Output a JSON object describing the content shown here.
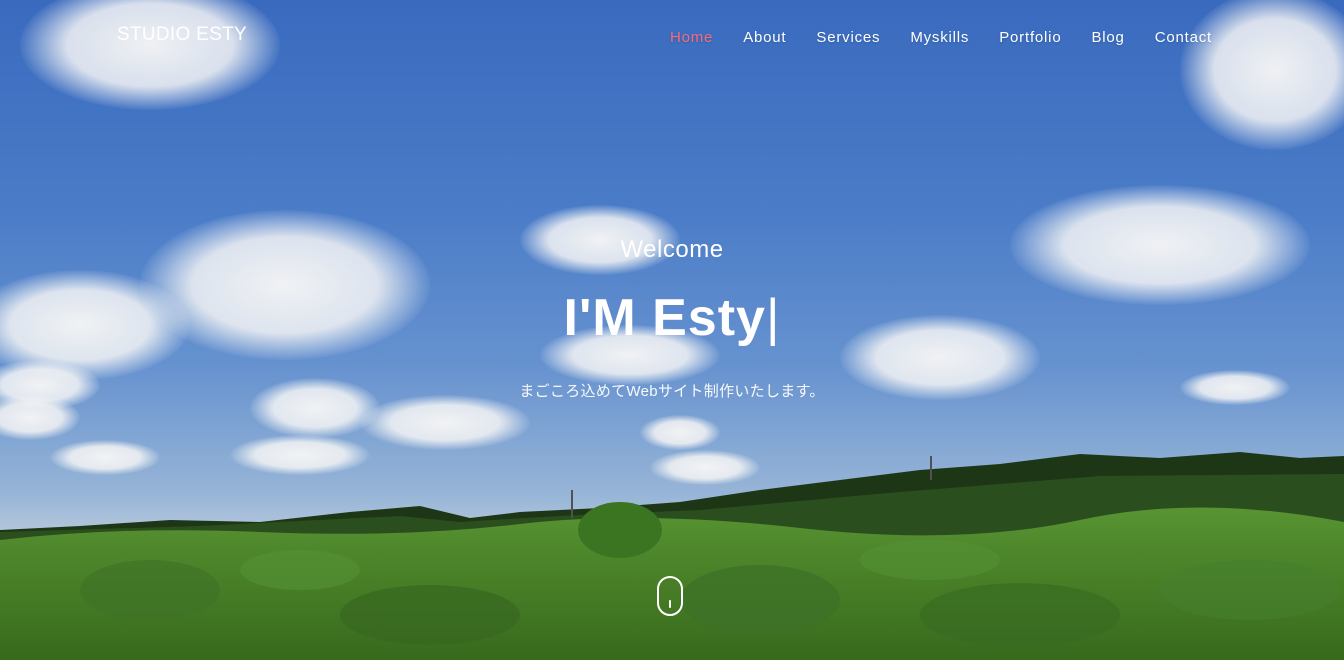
{
  "brand": "STUDIO ESTY",
  "nav": {
    "items": [
      {
        "label": "Home",
        "active": true
      },
      {
        "label": "About",
        "active": false
      },
      {
        "label": "Services",
        "active": false
      },
      {
        "label": "Myskills",
        "active": false
      },
      {
        "label": "Portfolio",
        "active": false
      },
      {
        "label": "Blog",
        "active": false
      },
      {
        "label": "Contact",
        "active": false
      }
    ],
    "active_color": "#f56b7a"
  },
  "hero": {
    "welcome": "Welcome",
    "headline": "I'M Esty",
    "cursor": "|",
    "subtitle": "まごころ込めてWebサイト制作いたします。"
  },
  "icons": {
    "scroll_indicator": "mouse-scroll-icon"
  },
  "colors": {
    "sky": "#4c80d0",
    "grass": "#4f8a2e",
    "tree_line": "#1f3a17",
    "text": "#ffffff"
  }
}
